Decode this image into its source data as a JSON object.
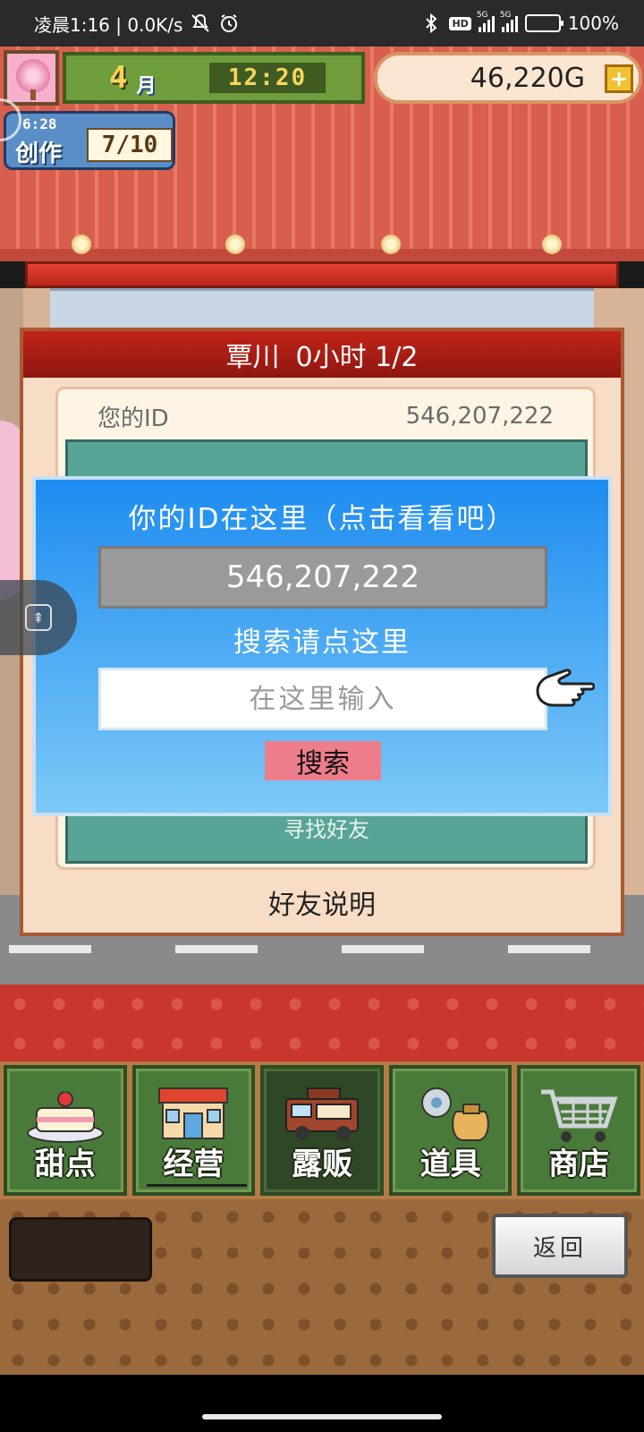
{
  "status_bar": {
    "time_text": "凌晨1:16 | 0.0K/s",
    "hd_badge": "HD",
    "network_5g": "5G",
    "battery_text": "100%",
    "battery_level": 1.0,
    "icons": [
      "mute-icon",
      "alarm-icon",
      "bluetooth-icon",
      "signal-icon",
      "battery-icon"
    ]
  },
  "hud": {
    "month_number": "4",
    "month_label": "月",
    "clock": "12:20",
    "money": "46,220G",
    "money_add_label": "+",
    "create_timer": "6:28",
    "create_label": "创作",
    "create_count": "7/10"
  },
  "panel": {
    "title_name": "覃川",
    "title_status": "0小时 1/2",
    "id_label": "您的ID",
    "id_value": "546,207,222",
    "find_friends_label": "寻找好友",
    "footer_label": "好友说明"
  },
  "dialog": {
    "title": "你的ID在这里（点击看看吧）",
    "id_value": "546,207,222",
    "search_hint": "搜索请点这里",
    "input_placeholder": "在这里输入",
    "input_value": "",
    "search_button": "搜索"
  },
  "bottom_nav": {
    "items": [
      {
        "label": "甜点",
        "icon": "cake-icon",
        "active": false
      },
      {
        "label": "经营",
        "icon": "shop-icon",
        "active": false,
        "progress": 0.08
      },
      {
        "label": "露贩",
        "icon": "food-truck-icon",
        "active": true
      },
      {
        "label": "道具",
        "icon": "tools-bag-icon",
        "active": false
      },
      {
        "label": "商店",
        "icon": "shopping-cart-icon",
        "active": false
      }
    ]
  },
  "tray": {
    "back_button": "返回"
  },
  "colors": {
    "dialog_top": "#1e8cf0",
    "dialog_bottom": "#7cc9f7",
    "panel_title": "#c22418",
    "search_button": "#ee7d8b",
    "nav_green": "#4a7a3a"
  }
}
